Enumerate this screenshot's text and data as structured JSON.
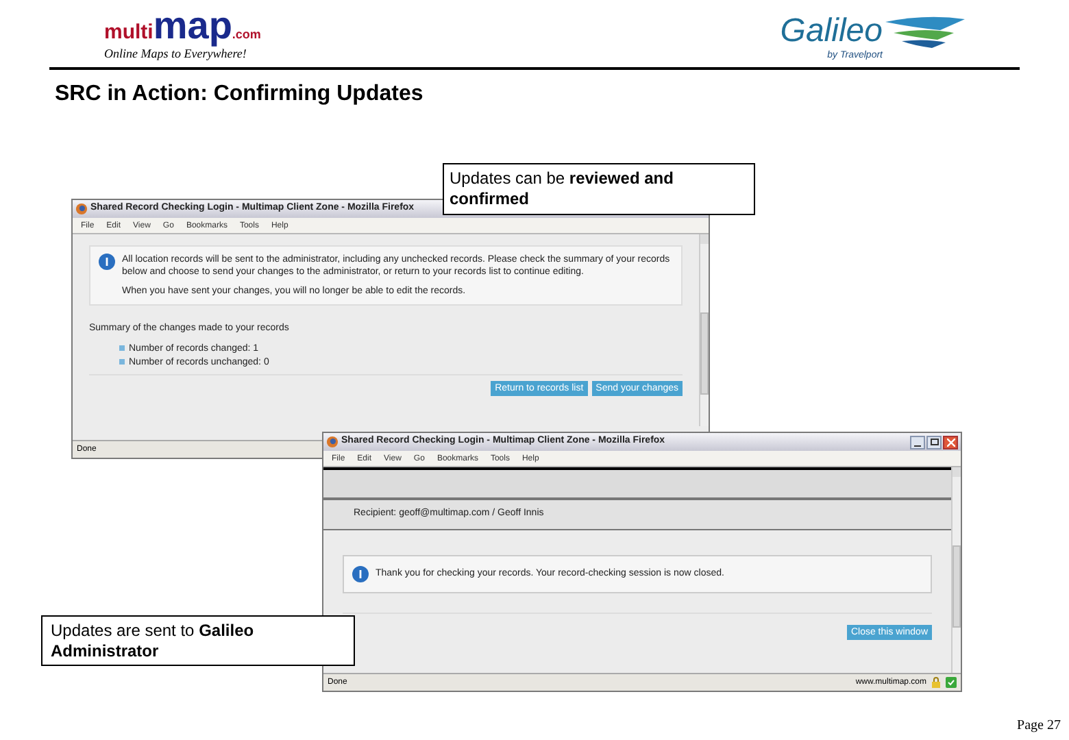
{
  "header": {
    "logo": {
      "part_1": "multi",
      "part_2": "map",
      "part_3": ".com"
    },
    "tagline": "Online Maps to Everywhere!",
    "partner_logo": {
      "name": "Galileo",
      "byline": "by Travelport"
    }
  },
  "title": "SRC in Action: Confirming Updates",
  "review_window": {
    "title": "Shared Record Checking Login - Multimap Client Zone - Mozilla Firefox",
    "menu": [
      "File",
      "Edit",
      "View",
      "Go",
      "Bookmarks",
      "Tools",
      "Help"
    ],
    "notice": [
      "All location records will be sent to the administrator, including any unchecked records. Please check the summary of your records below and choose to send your changes to the administrator, or return to your records list to continue editing.",
      "When you have sent your changes, you will no longer be able to edit the records."
    ],
    "summary_heading": "Summary of the changes made to your records",
    "summary_items": [
      "Number of records changed: 1",
      "Number of records unchanged: 0"
    ],
    "buttons": [
      "Return to records list",
      "Send your changes"
    ],
    "status": "Done"
  },
  "confirmation_window": {
    "title": "Shared Record Checking Login - Multimap Client Zone - Mozilla Firefox",
    "menu": [
      "File",
      "Edit",
      "View",
      "Go",
      "Bookmarks",
      "Tools",
      "Help"
    ],
    "recipient": "Recipient: geoff@multimap.com / Geoff Innis",
    "notice": "Thank you for checking your records. Your record-checking session is now closed.",
    "buttons": [
      "Close this window"
    ],
    "status": "Done",
    "status_url": "www.multimap.com"
  },
  "callouts": [
    {
      "text": "Updates can be **reviewed and confirmed**"
    },
    {
      "text": "Updates are sent to **Galileo Administrator**"
    }
  ],
  "footer": {
    "page": "Page 27"
  }
}
